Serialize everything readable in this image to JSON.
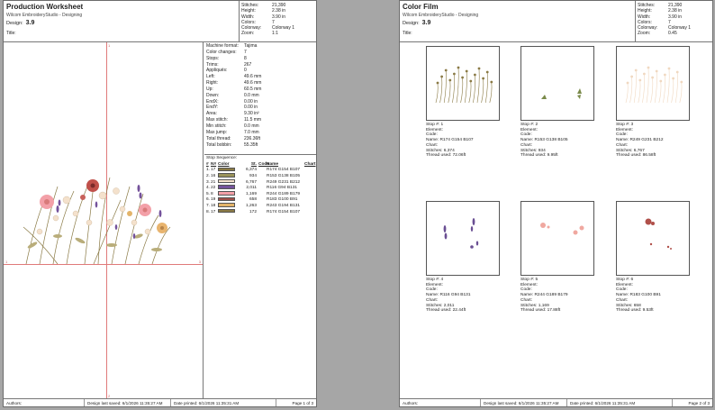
{
  "colors": {
    "guide": "#e07a7a",
    "page_bg": "#ffffff",
    "desk_bg": "#a6a6a6"
  },
  "common": {
    "company": "Wilcom EmbroideryStudio - Designing",
    "design_label": "Design:",
    "design_value": "3.9",
    "title_label": "Title:",
    "stats": [
      {
        "k": "Stitches:",
        "v": "21,390"
      },
      {
        "k": "Height:",
        "v": "2.38 in"
      },
      {
        "k": "Width:",
        "v": "3.90 in"
      },
      {
        "k": "Colors:",
        "v": "7"
      },
      {
        "k": "Colorway:",
        "v": "Colorway 1"
      }
    ],
    "authors_label": "Authors:",
    "saved": "Design last saved:  6/1/2026 11:35:27 AM",
    "printed": "Date printed:  6/1/2026 11:35:31 AM"
  },
  "worksheet": {
    "title": "Production Worksheet",
    "zoom": {
      "k": "Zoom:",
      "v": "1:1"
    },
    "page": "Page 1 of 3",
    "guide_labels": {
      "top": "1",
      "bottom": "2",
      "left": "1",
      "right": "3"
    },
    "info": [
      {
        "k": "Machine format:",
        "v": "Tajima"
      },
      {
        "k": "Color changes:",
        "v": "7"
      },
      {
        "k": "Stops:",
        "v": "8"
      },
      {
        "k": "Trims:",
        "v": "267"
      },
      {
        "k": "Appliqués:",
        "v": "0"
      },
      {
        "k": "Left:",
        "v": "49.6 mm"
      },
      {
        "k": "Right:",
        "v": "49.6 mm"
      },
      {
        "k": "Up:",
        "v": "60.5 mm"
      },
      {
        "k": "Down:",
        "v": "0.0 mm"
      },
      {
        "k": "EndX:",
        "v": "0.00 in"
      },
      {
        "k": "EndY:",
        "v": "0.00 in"
      },
      {
        "k": "Area:",
        "v": "9.30 in²"
      },
      {
        "k": "Max stitch:",
        "v": "11.5 mm"
      },
      {
        "k": "Min stitch:",
        "v": "0.0 mm"
      },
      {
        "k": "Max jump:",
        "v": "7.0 mm"
      },
      {
        "k": "Total thread:",
        "v": "236.36ft"
      },
      {
        "k": "Total bobbin:",
        "v": "55.35ft"
      }
    ],
    "stop_sequence": {
      "caption": "Stop Sequence:",
      "headers": [
        "#",
        "N#",
        "Color",
        "St.",
        "Code",
        "Name",
        "Chart"
      ],
      "rows": [
        {
          "n": "1.",
          "num": "17",
          "color": "#8a7a45",
          "st": "6,374",
          "code": "",
          "name": "R174 G154 B107",
          "chart": ""
        },
        {
          "n": "2.",
          "num": "16",
          "color": "#99925a",
          "st": "934",
          "code": "",
          "name": "R153 G138 B105",
          "chart": ""
        },
        {
          "n": "3.",
          "num": "21",
          "color": "#f4e1cc",
          "st": "6,767",
          "code": "",
          "name": "R249 G231 B212",
          "chart": ""
        },
        {
          "n": "4.",
          "num": "22",
          "color": "#74529b",
          "st": "2,011",
          "code": "",
          "name": "R116 G94 B131",
          "chart": ""
        },
        {
          "n": "5.",
          "num": "8",
          "color": "#f3a0a8",
          "st": "1,169",
          "code": "",
          "name": "R244 G189 B179",
          "chart": ""
        },
        {
          "n": "6.",
          "num": "19",
          "color": "#a0504a",
          "st": "658",
          "code": "",
          "name": "R183 G100 B91",
          "chart": ""
        },
        {
          "n": "7.",
          "num": "18",
          "color": "#e3b46a",
          "st": "1,263",
          "code": "",
          "name": "R243 G194 B131",
          "chart": ""
        },
        {
          "n": "8.",
          "num": "17",
          "color": "#8a7a45",
          "st": "172",
          "code": "",
          "name": "R174 G154 B107",
          "chart": ""
        }
      ]
    }
  },
  "colorfilm": {
    "title": "Color Film",
    "zoom": {
      "k": "Zoom:",
      "v": "0.45"
    },
    "page": "Page 2 of 3",
    "tiles": [
      {
        "stop": "Stop #: 1",
        "element": "Element:",
        "code": "Code:",
        "name": "Name: R174 G154 B107",
        "chart": "Chart:",
        "stitches": "Stitches: 6,374",
        "thread": "Thread used: 72.06ft",
        "color": "#8a7a45",
        "kind": "full"
      },
      {
        "stop": "Stop #: 2",
        "element": "Element:",
        "code": "Code:",
        "name": "Name: R153 G138 B105",
        "chart": "Chart:",
        "stitches": "Stitches: 934",
        "thread": "Thread used: 9.95ft",
        "color": "#7a8a4a",
        "kind": "leaves"
      },
      {
        "stop": "Stop #: 3",
        "element": "Element:",
        "code": "Code:",
        "name": "Name: R249 G231 B212",
        "chart": "Chart:",
        "stitches": "Stitches: 6,767",
        "thread": "Thread used: 86.58ft",
        "color": "#f0d8c0",
        "kind": "full"
      },
      {
        "stop": "Stop #: 4",
        "element": "Element:",
        "code": "Code:",
        "name": "Name: R116 G94 B131",
        "chart": "Chart:",
        "stitches": "Stitches: 2,011",
        "thread": "Thread used: 22.44ft",
        "color": "#6a4f93",
        "kind": "lavender"
      },
      {
        "stop": "Stop #: 5",
        "element": "Element:",
        "code": "Code:",
        "name": "Name: R244 G189 B179",
        "chart": "Chart:",
        "stitches": "Stitches: 1,169",
        "thread": "Thread used: 17.88ft",
        "color": "#f0a8a0",
        "kind": "dots"
      },
      {
        "stop": "Stop #: 6",
        "element": "Element:",
        "code": "Code:",
        "name": "Name: R183 G100 B91",
        "chart": "Chart:",
        "stitches": "Stitches: 658",
        "thread": "Thread used: 9.53ft",
        "color": "#b0504a",
        "kind": "red"
      }
    ]
  }
}
